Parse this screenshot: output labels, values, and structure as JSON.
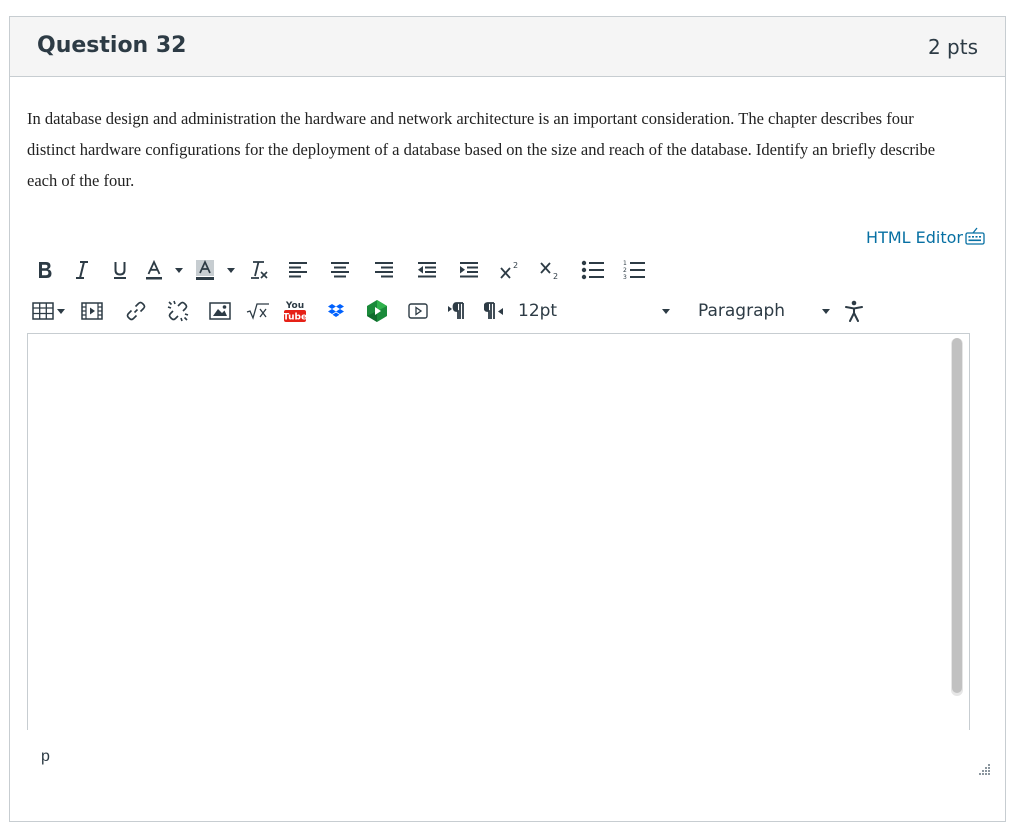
{
  "question": {
    "title": "Question 32",
    "points": "2 pts",
    "text": "In database design and administration the hardware and network architecture is an important consideration. The chapter describes four distinct hardware configurations for the deployment of a database based on the size and reach of the database.  Identify an briefly describe each of the four."
  },
  "editor": {
    "html_editor_label": "HTML Editor",
    "font_size": "12pt",
    "block_format": "Paragraph",
    "status_path": "p",
    "content": ""
  },
  "icons": {
    "toolbar_row1": [
      "bold-icon",
      "italic-icon",
      "underline-icon",
      "text-color-icon",
      "background-color-icon",
      "clear-formatting-icon",
      "align-left-icon",
      "align-center-icon",
      "align-right-icon",
      "outdent-icon",
      "indent-icon",
      "superscript-icon",
      "subscript-icon",
      "bullet-list-icon",
      "numbered-list-icon"
    ],
    "toolbar_row2": [
      "table-icon",
      "media-icon",
      "link-icon",
      "unlink-icon",
      "image-icon",
      "math-equation-icon",
      "youtube-icon",
      "dropbox-icon",
      "google-drive-icon",
      "video-icon",
      "ltr-icon",
      "rtl-icon",
      "accessibility-icon"
    ]
  },
  "colors": {
    "link": "#0770a3",
    "header_bg": "#f5f5f5",
    "border": "#c7cdd1",
    "text": "#2d3b45",
    "youtube_red": "#e62117"
  }
}
